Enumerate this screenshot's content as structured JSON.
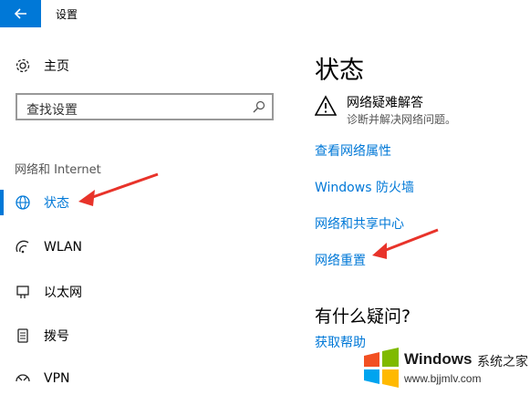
{
  "window": {
    "title": "设置"
  },
  "sidebar": {
    "home_label": "主页",
    "search_placeholder": "查找设置",
    "section_label": "网络和 Internet",
    "items": [
      {
        "label": "状态",
        "icon": "globe-icon",
        "active": true
      },
      {
        "label": "WLAN",
        "icon": "wifi-icon"
      },
      {
        "label": "以太网",
        "icon": "ethernet-icon"
      },
      {
        "label": "拨号",
        "icon": "phone-icon"
      },
      {
        "label": "VPN",
        "icon": "vpn-icon"
      }
    ]
  },
  "main": {
    "title": "状态",
    "troubleshoot": {
      "title": "网络疑难解答",
      "subtitle": "诊断并解决网络问题。"
    },
    "links": [
      "查看网络属性",
      "Windows 防火墙",
      "网络和共享中心",
      "网络重置"
    ],
    "question": "有什么疑问?",
    "help_link": "获取帮助"
  },
  "watermark": {
    "brand": "Windows",
    "brand_cn": "系统之家",
    "url": "www.bjjmlv.com"
  },
  "colors": {
    "accent": "#0078d7",
    "annotation_arrow": "#e8332a"
  }
}
